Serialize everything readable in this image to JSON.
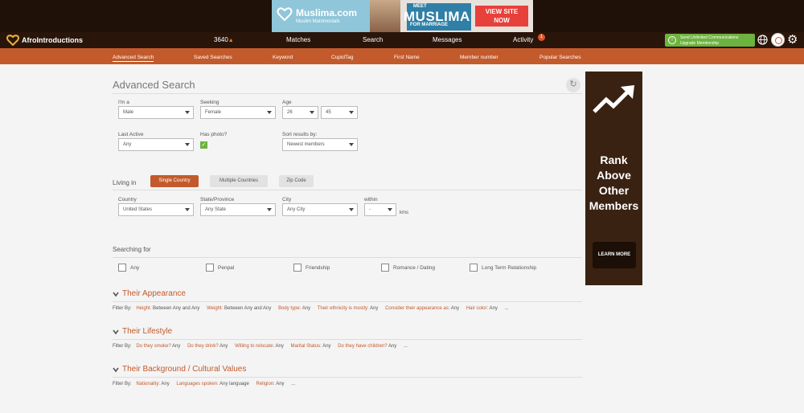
{
  "banner": {
    "brand": "Muslima.com",
    "subtitle": "Muslim Matrimonials",
    "meet_line1": "MEET",
    "meet_line2": "MUSLIMA",
    "meet_line3": "FOR MARRIAGE",
    "cta_line1": "VIEW SITE",
    "cta_line2": "NOW"
  },
  "topnav": {
    "logo": "AfroIntroductions",
    "coins": "3640",
    "items": [
      "Matches",
      "Search",
      "Messages",
      "Activity"
    ],
    "activity_badge": "1",
    "upgrade_line1": "Send Unlimited Communications",
    "upgrade_line2": "Upgrade Membership"
  },
  "subnav": {
    "items": [
      "Advanced Search",
      "Saved Searches",
      "Keyword",
      "CupidTag",
      "First Name",
      "Member number",
      "Popular Searches"
    ]
  },
  "page_title": "Advanced Search",
  "form": {
    "im_a": {
      "label": "I'm a",
      "value": "Male"
    },
    "seeking": {
      "label": "Seeking",
      "value": "Female"
    },
    "age": {
      "label": "Age",
      "from": "26",
      "to": "45"
    },
    "last_active": {
      "label": "Last Active",
      "value": "Any"
    },
    "has_photo": {
      "label": "Has photo?",
      "checked": true
    },
    "sort": {
      "label": "Sort results by:",
      "value": "Newest members"
    }
  },
  "living": {
    "label": "Living in",
    "tabs": [
      "Single Country",
      "Multiple Countries",
      "Zip Code"
    ],
    "active_tab": "Single Country",
    "country": {
      "label": "Country",
      "value": "United States"
    },
    "state": {
      "label": "State/Province",
      "value": "Any State"
    },
    "city": {
      "label": "City",
      "value": "Any City"
    },
    "within": {
      "label": "within",
      "value": "-",
      "unit": "kms"
    }
  },
  "searching_for": {
    "label": "Searching for",
    "options": [
      "Any",
      "Penpal",
      "Friendship",
      "Romance / Dating",
      "Long Term Relationship"
    ]
  },
  "sections": [
    {
      "title": "Their Appearance",
      "filter_by": "Filter By:",
      "filters": [
        {
          "key": "Height:",
          "value": "Between Any and Any"
        },
        {
          "key": "Weight:",
          "value": "Between Any and Any"
        },
        {
          "key": "Body type:",
          "value": "Any"
        },
        {
          "key": "Their ethnicity is mostly:",
          "value": "Any"
        },
        {
          "key": "Consider their appearance as:",
          "value": "Any"
        },
        {
          "key": "Hair color:",
          "value": "Any"
        }
      ],
      "more": "..."
    },
    {
      "title": "Their Lifestyle",
      "filter_by": "Filter By:",
      "filters": [
        {
          "key": "Do they smoke?",
          "value": "Any"
        },
        {
          "key": "Do they drink?",
          "value": "Any"
        },
        {
          "key": "Willing to relocate:",
          "value": "Any"
        },
        {
          "key": "Marital Status:",
          "value": "Any"
        },
        {
          "key": "Do they have children?",
          "value": "Any"
        }
      ],
      "more": "..."
    },
    {
      "title": "Their Background / Cultural Values",
      "filter_by": "Filter By:",
      "filters": [
        {
          "key": "Nationality:",
          "value": "Any"
        },
        {
          "key": "Languages spoken:",
          "value": "Any language"
        },
        {
          "key": "Religion:",
          "value": "Any"
        }
      ],
      "more": "..."
    }
  ],
  "ad": {
    "line1": "Rank",
    "line2": "Above",
    "line3": "Other",
    "line4": "Members",
    "button": "LEARN MORE"
  },
  "colors": {
    "accent": "#c35a2b",
    "header": "#2a150a",
    "upgrade": "#6db33f"
  }
}
